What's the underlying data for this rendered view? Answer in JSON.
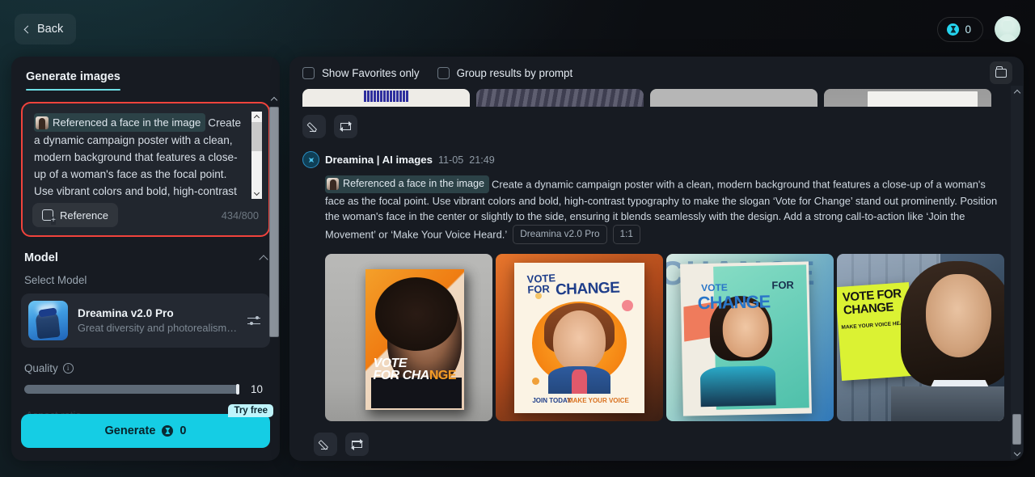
{
  "topbar": {
    "back_label": "Back",
    "credits_count": "0",
    "coin_icon": "coin-icon",
    "avatar_icon": "user-avatar"
  },
  "left_panel": {
    "tab_label": "Generate images",
    "prompt": {
      "reference_chip_label": "Referenced a face in the image",
      "text": "Create a dynamic campaign poster with a clean, modern background that features a close-up of a woman's face as the focal point. Use vibrant colors and bold, high-contrast",
      "reference_button_label": "Reference",
      "char_count": "434/800"
    },
    "model_section": {
      "title": "Model",
      "select_label": "Select Model",
      "model_name": "Dreamina v2.0 Pro",
      "model_desc": "Great diversity and photorealism. ..."
    },
    "quality": {
      "label": "Quality",
      "value": "10"
    },
    "generate": {
      "label": "Generate",
      "cost": "0",
      "badge": "Try free"
    }
  },
  "right_panel": {
    "show_favorites_label": "Show Favorites only",
    "group_results_label": "Group results by prompt",
    "folder_icon": "folder-icon",
    "generation": {
      "app_name": "Dreamina | AI images",
      "date": "11-05",
      "time": "21:49",
      "reference_chip_label": "Referenced a face in the image",
      "prompt": "Create a dynamic campaign poster with a clean, modern background that features a close-up of a woman's face as the focal point. Use vibrant colors and bold, high-contrast typography to make the slogan ‘Vote for Change’ stand out prominently. Position the woman's face in the center or slightly to the side, ensuring it blends seamlessly with the design. Add a strong call-to-action like ‘Join the Movement’ or ‘Make Your Voice Heard.’",
      "model_tag": "Dreamina v2.0 Pro",
      "ratio_tag": "1:1",
      "images": [
        {
          "alt": "Orange campaign poster with curly-haired woman",
          "slogan_line1": "VOTE",
          "slogan_line2": "FOR CHA",
          "slogan_accent": "NGE"
        },
        {
          "alt": "Illustrated poster with woman in blue blazer",
          "slogan_line1": "VOTE",
          "slogan_line2": "FOR",
          "slogan_accent": "CHANGE",
          "footer_left": "JOIN TODAY",
          "footer_right": "MAKE YOUR VOICE"
        },
        {
          "alt": "Teal poster with smiling woman",
          "slogan_line1": "VOTE",
          "slogan_line2": "FOR",
          "slogan_accent": "CHANGE"
        },
        {
          "alt": "Photo of woman beside yellow VOTE FOR CHANGE sign",
          "sign_text": "VOTE FOR CHANGE",
          "sign_sub": "MAKE YOUR VOICE HEARD"
        }
      ]
    }
  }
}
